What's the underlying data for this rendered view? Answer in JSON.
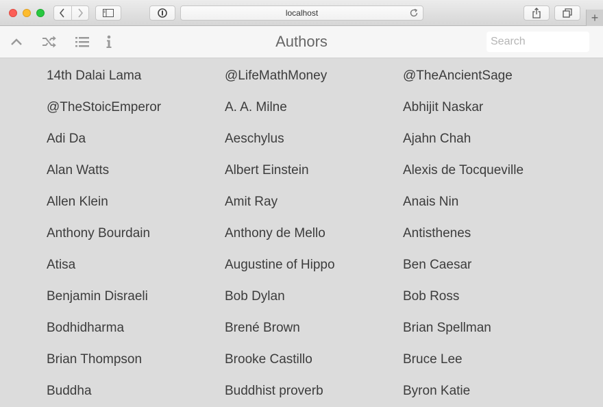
{
  "browser": {
    "url": "localhost"
  },
  "toolbar": {
    "title": "Authors",
    "search_placeholder": "Search"
  },
  "authors": [
    "14th Dalai Lama",
    "@LifeMathMoney",
    "@TheAncientSage",
    "@TheStoicEmperor",
    "A. A. Milne",
    "Abhijit Naskar",
    "Adi Da",
    "Aeschylus",
    "Ajahn Chah",
    "Alan Watts",
    "Albert Einstein",
    "Alexis de Tocqueville",
    "Allen Klein",
    "Amit Ray",
    "Anais Nin",
    "Anthony Bourdain",
    "Anthony de Mello",
    "Antisthenes",
    "Atisa",
    "Augustine of Hippo",
    "Ben Caesar",
    "Benjamin Disraeli",
    "Bob Dylan",
    "Bob Ross",
    "Bodhidharma",
    "Brené Brown",
    "Brian Spellman",
    "Brian Thompson",
    "Brooke Castillo",
    "Bruce Lee",
    "Buddha",
    "Buddhist proverb",
    "Byron Katie"
  ]
}
